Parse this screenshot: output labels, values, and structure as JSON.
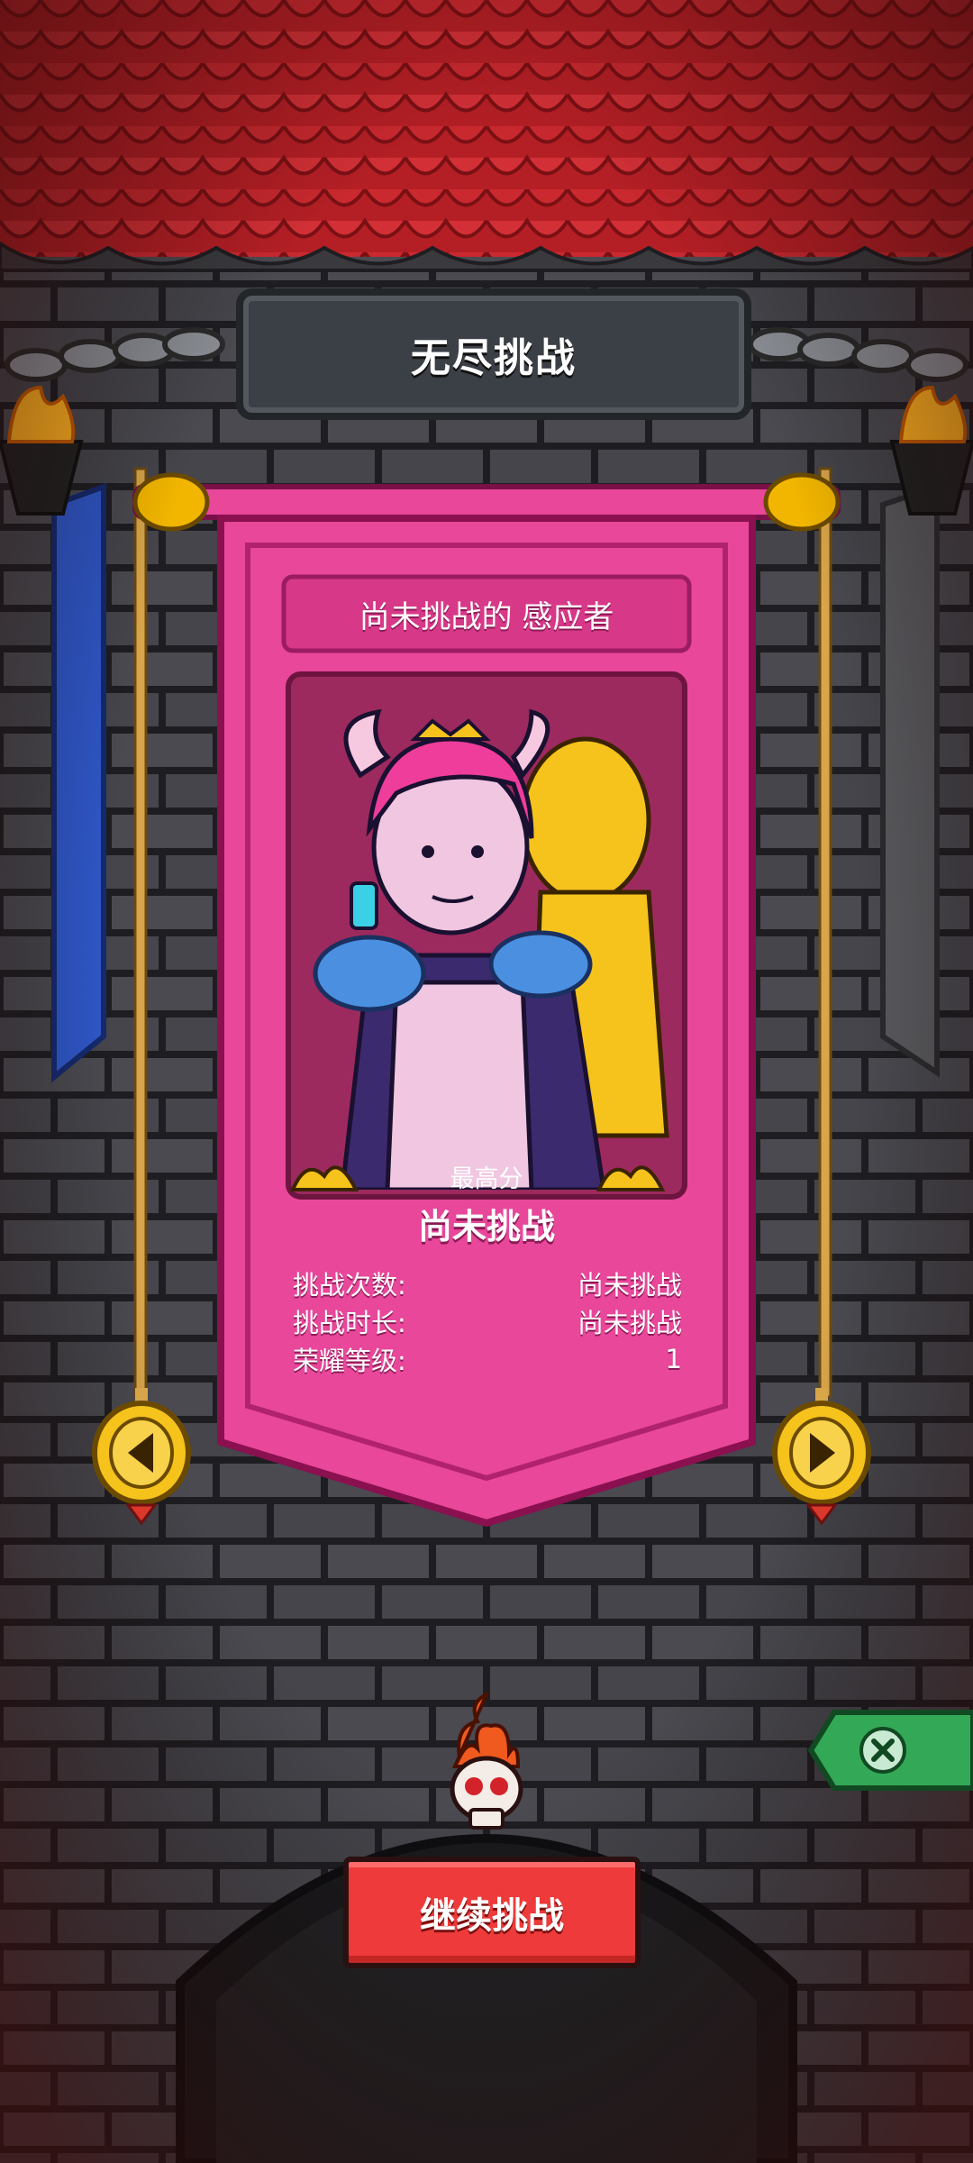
{
  "screen": {
    "title": "无尽挑战"
  },
  "card": {
    "header": "尚未挑战的 感应者",
    "character_image": "two-horned-women-illustration",
    "score_label": "最高分",
    "score_value": "尚未挑战",
    "stats": [
      {
        "label": "挑战次数:",
        "value": "尚未挑战"
      },
      {
        "label": "挑战时长:",
        "value": "尚未挑战"
      },
      {
        "label": "荣耀等级:",
        "value": "1"
      }
    ]
  },
  "actions": {
    "continue_label": "继续挑战",
    "prev_icon": "left-arrow-icon",
    "next_icon": "right-arrow-icon",
    "side_tab_icon": "close-x-icon"
  },
  "colors": {
    "banner_pink": "#e8479a",
    "banner_dark": "#b0226e",
    "roof_red": "#c4272b",
    "button_red": "#ee3a3a",
    "tab_green": "#33a957"
  }
}
